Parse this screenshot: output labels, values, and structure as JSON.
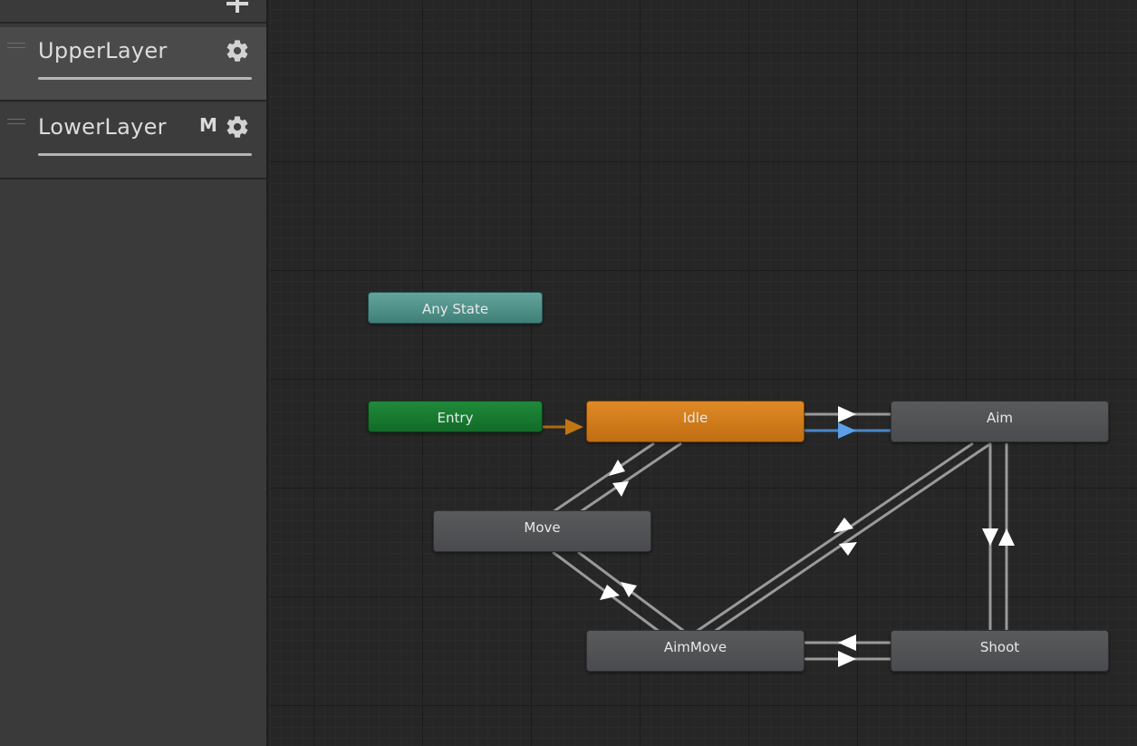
{
  "sidebar": {
    "add_icon": "plus-icon",
    "layers": [
      {
        "name": "UpperLayer",
        "selected": true,
        "badge": "",
        "settings_icon": "gear-icon"
      },
      {
        "name": "LowerLayer",
        "selected": false,
        "badge": "M",
        "settings_icon": "gear-icon"
      }
    ]
  },
  "graph": {
    "states": {
      "any_state": "Any State",
      "entry": "Entry",
      "idle": "Idle",
      "aim": "Aim",
      "move": "Move",
      "aim_move": "AimMove",
      "shoot": "Shoot"
    },
    "colors": {
      "default_state": "#C06E12",
      "entry": "#126B28",
      "any_state": "#3F7F77",
      "state": "#4A4B4E",
      "selected_transition": "#5B9FE6"
    }
  }
}
